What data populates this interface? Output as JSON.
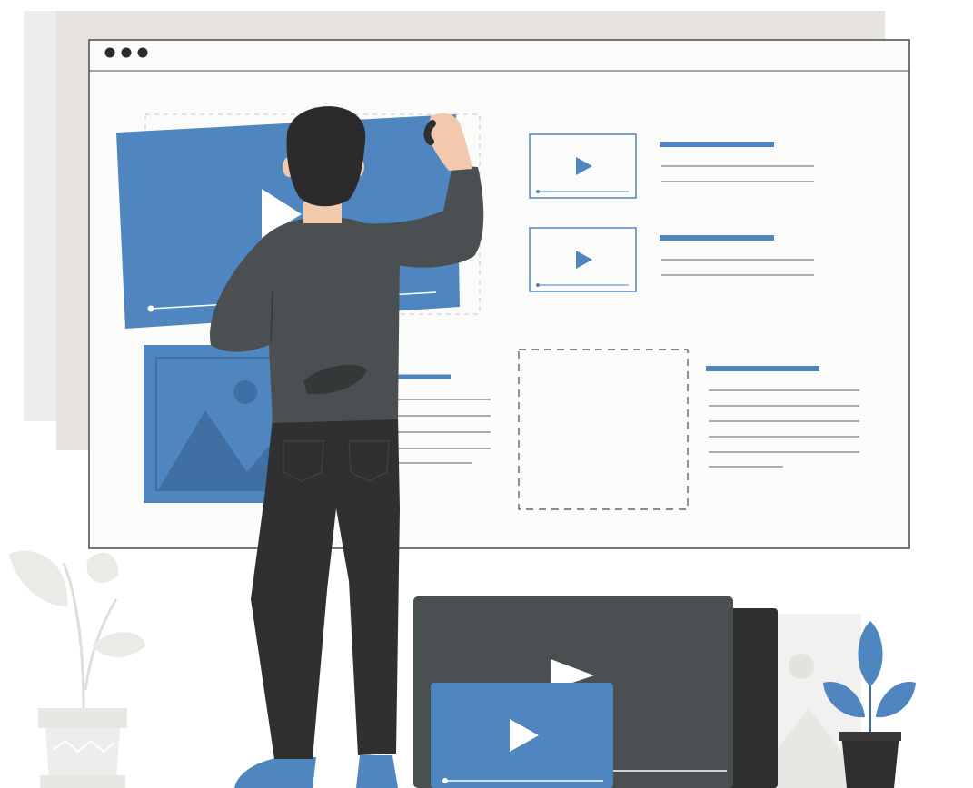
{
  "colors": {
    "background": "#ffffff",
    "shadow_panel": "#e6e3e0",
    "shadow_panel_light": "#efedeb",
    "window_fill": "#fbfbfa",
    "window_border": "#4a4a4a",
    "accent_blue": "#4f86c0",
    "accent_blue_dark": "#3f6fa3",
    "line_gray": "#5c5c5c",
    "shirt": "#4a5052",
    "shirt_shadow": "#343839",
    "pants": "#2f3030",
    "hair": "#2b2b2b",
    "skin": "#f2c9ad",
    "shoe": "#4f86c0",
    "pot_gray": "#e9e7e4",
    "pot_dark": "#2f2f2f",
    "tv_dark": "#4a5052",
    "tv_back": "#2f3030"
  },
  "icons": {
    "window_dots": "three-dots-icon",
    "play": "play-icon",
    "image": "image-placeholder-icon",
    "plant": "plant-icon"
  }
}
